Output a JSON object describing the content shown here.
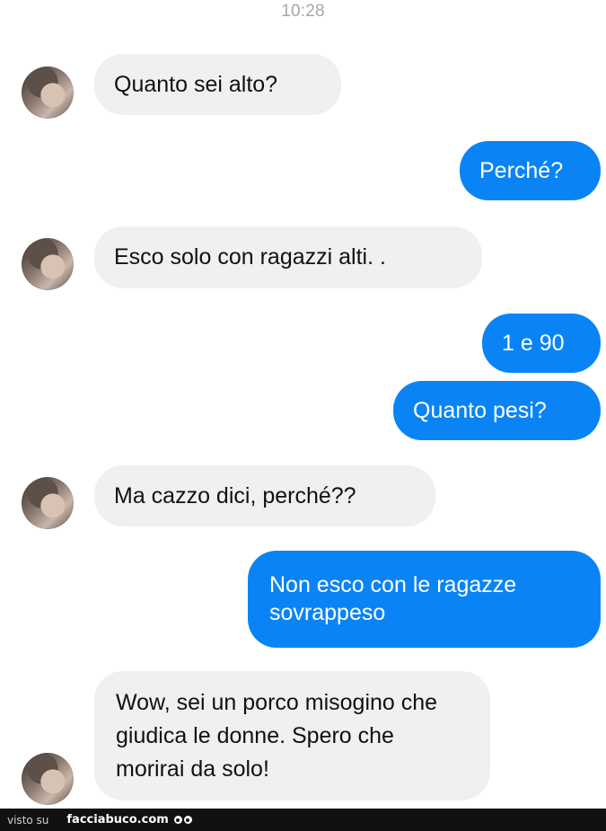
{
  "status_bar": {
    "time": "10:28"
  },
  "messages": [
    {
      "from": "them",
      "text": "Quanto sei alto?"
    },
    {
      "from": "me",
      "text": "Perché?"
    },
    {
      "from": "them",
      "text": "Esco solo con ragazzi alti. ."
    },
    {
      "from": "me",
      "text": "1 e 90"
    },
    {
      "from": "me",
      "text": "Quanto pesi?"
    },
    {
      "from": "them",
      "text": "Ma cazzo dici, perché??"
    },
    {
      "from": "me",
      "text": "Non esco con le ragazze sovrappeso"
    },
    {
      "from": "them",
      "text": "Wow, sei un porco misogino che giudica le donne. Spero che morirai da solo!"
    }
  ],
  "colors": {
    "outgoing_bubble": "#0a84f5",
    "incoming_bubble": "#f0f0f0",
    "timestamp": "#a7a7a7"
  },
  "footer": {
    "prefix": "visto su",
    "site": "facciabuco.com",
    "logo_icon": "eyes-icon"
  }
}
